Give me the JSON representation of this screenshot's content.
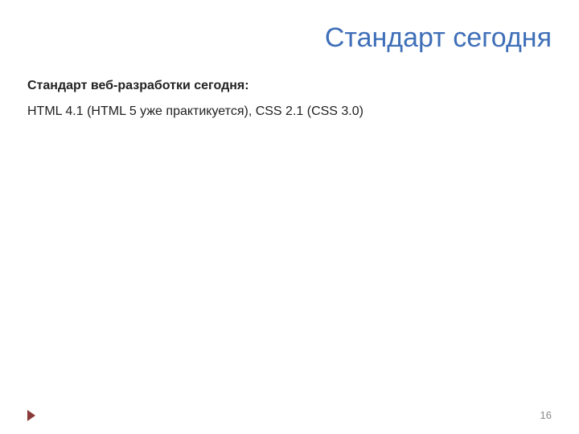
{
  "title": "Стандарт сегодня",
  "heading": "Стандарт веб-разработки сегодня:",
  "body": "HTML 4.1 (HTML 5 уже практикуется), CSS 2.1 (CSS 3.0)",
  "page_number": "16",
  "colors": {
    "title_color": "#3f6fb8",
    "arrow_color": "#8a3a3a"
  }
}
